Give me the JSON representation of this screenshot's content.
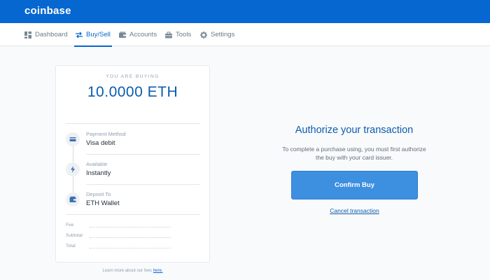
{
  "app": {
    "logo": "coinbase"
  },
  "nav": {
    "items": [
      {
        "label": "Dashboard",
        "icon": "dashboard-icon"
      },
      {
        "label": "Buy/Sell",
        "icon": "swap-icon",
        "active": true
      },
      {
        "label": "Accounts",
        "icon": "accounts-icon"
      },
      {
        "label": "Tools",
        "icon": "tools-icon"
      },
      {
        "label": "Settings",
        "icon": "gear-icon"
      }
    ]
  },
  "order": {
    "buying_label": "YOU ARE BUYING",
    "amount": "10.0000 ETH",
    "steps": [
      {
        "label": "Payment Method",
        "value": "Visa debit",
        "icon": "credit-card-icon"
      },
      {
        "label": "Available",
        "value": "Instantly",
        "icon": "lightning-icon"
      },
      {
        "label": "Deposit To",
        "value": "ETH Wallet",
        "icon": "wallet-icon"
      }
    ],
    "fees": {
      "fee_label": "Fee",
      "subtotal_label": "Subtotal",
      "total_label": "Total"
    },
    "fees_note": "Learn more about our fees",
    "fees_link": "here."
  },
  "authorize": {
    "title": "Authorize your transaction",
    "description": "To complete a purchase using, you must first authorize the buy with your card issuer.",
    "confirm_label": "Confirm Buy",
    "cancel_label": "Cancel transaction"
  },
  "colors": {
    "brand": "#0667d0",
    "button": "#3d8fe0",
    "heading": "#0b5cad"
  }
}
